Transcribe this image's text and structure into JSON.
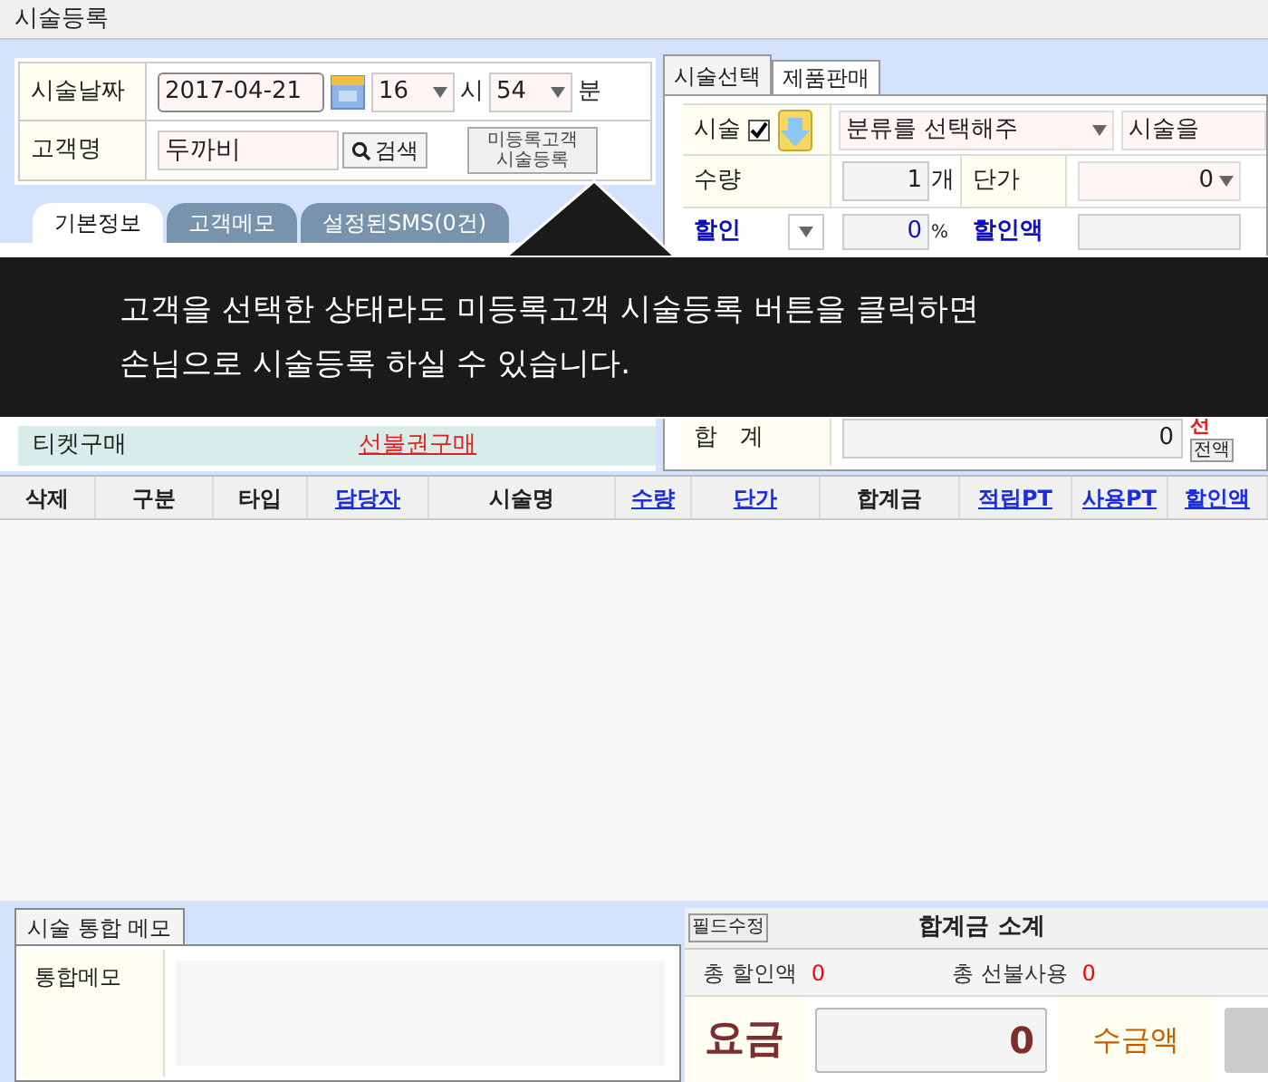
{
  "window": {
    "title": "시술등록"
  },
  "visit_form": {
    "date_label": "시술날짜",
    "date": "2017-04-21",
    "hour": "16",
    "hour_unit": "시",
    "minute": "54",
    "minute_unit": "분",
    "customer_label": "고객명",
    "customer": "두까비",
    "search_button": "검색",
    "unregistered_button": [
      "미등록고객",
      "시술등록"
    ]
  },
  "customer_tabs": [
    {
      "label": "기본정보",
      "selected": true
    },
    {
      "label": "고객메모",
      "selected": false
    },
    {
      "label": "설정된SMS(0건)",
      "selected": false
    }
  ],
  "ticket_row": {
    "label": "티켓구매",
    "link": "선불권구매"
  },
  "service_tabs": [
    {
      "label": "시술선택",
      "selected": true
    },
    {
      "label": "제품판매",
      "selected": false
    }
  ],
  "service_form": {
    "service_label": "시술",
    "service_checked": true,
    "category": "분류를 선택해주",
    "service": "시술을",
    "quantity_label": "수량",
    "quantity": "1",
    "quantity_unit": "개",
    "price_label": "단가",
    "price": "0",
    "discount_label": "할인",
    "discount": "0",
    "discount_unit": "%",
    "discount_amount_label": "할인액",
    "total_label": "합   계",
    "total": "0",
    "prepaid_label": "선",
    "full_button": "전액"
  },
  "grid": {
    "columns": [
      {
        "label": "삭제",
        "kind": "plain"
      },
      {
        "label": "구분",
        "kind": "plain"
      },
      {
        "label": "타입",
        "kind": "plain"
      },
      {
        "label": "담당자",
        "kind": "link"
      },
      {
        "label": "시술명",
        "kind": "plain"
      },
      {
        "label": "수량",
        "kind": "link"
      },
      {
        "label": "단가",
        "kind": "link"
      },
      {
        "label": "합계금",
        "kind": "plain"
      },
      {
        "label": "적립PT",
        "kind": "link"
      },
      {
        "label": "사용PT",
        "kind": "link"
      },
      {
        "label": "할인액",
        "kind": "link"
      }
    ]
  },
  "memo_tabs": [
    {
      "label": "시술 통합 메모",
      "selected": true
    }
  ],
  "memo": {
    "label": "통합메모"
  },
  "summary": {
    "edit_button": "필드수정",
    "title": "합계금 소계",
    "total_discount_label": "총 할인액",
    "total_discount": "0",
    "prepaid_label": "총 선불사용",
    "prepaid": "0",
    "fee_label": "요금",
    "fee": "0",
    "received_label": "수금액"
  },
  "tooltip": {
    "lines": [
      "고객을 선택한 상태라도 미등록고객 시술등록 버튼을 클릭하면",
      "손님으로 시술등록 하실 수 있습니다."
    ]
  }
}
